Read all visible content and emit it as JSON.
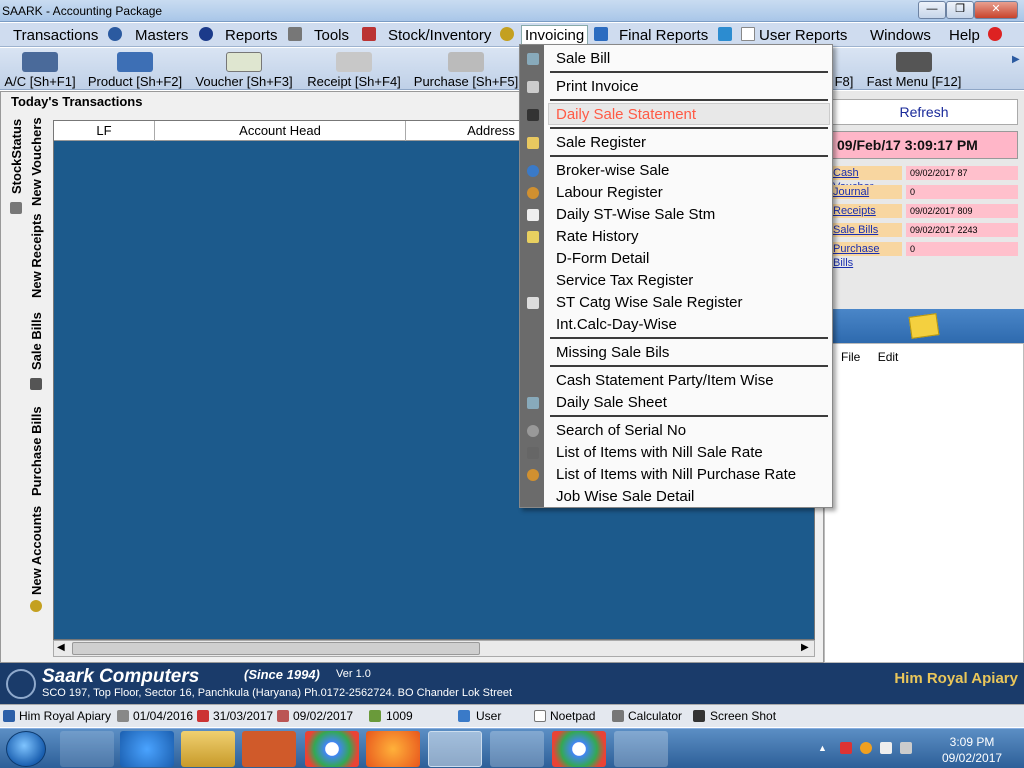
{
  "window": {
    "title": "SAARK - Accounting Package",
    "btn_min": "—",
    "btn_max": "❐",
    "btn_close": "✕"
  },
  "menubar": [
    {
      "label": "Transactions"
    },
    {
      "label": "Masters"
    },
    {
      "label": "Reports"
    },
    {
      "label": "Tools"
    },
    {
      "label": "Stock/Inventory"
    },
    {
      "label": "Invoicing"
    },
    {
      "label": "Final Reports"
    },
    {
      "label": "User Reports"
    },
    {
      "label": "Windows"
    },
    {
      "label": "Help"
    }
  ],
  "toolbar": [
    {
      "label": "A/C [Sh+F1]"
    },
    {
      "label": "Product [Sh+F2]"
    },
    {
      "label": "Voucher [Sh+F3]"
    },
    {
      "label": "Receipt [Sh+F4]"
    },
    {
      "label": "Purchase [Sh+F5]"
    },
    {
      "label": "F8]"
    },
    {
      "label": "Fast Menu [F12]"
    }
  ],
  "left": {
    "section_title": "Today's Transactions",
    "vertical_tabs": [
      "StockStatus",
      "New Vouchers",
      "New Receipts",
      "Sale Bills",
      "Purchase Bills",
      "New Accounts"
    ],
    "grid_headers": [
      "LF",
      "Account Head",
      "Address"
    ]
  },
  "right": {
    "refresh_label": "Refresh",
    "datetime": "09/Feb/17 3:09:17 PM",
    "summary": [
      {
        "label": "Cash Voucher",
        "value": "09/02/2017 87"
      },
      {
        "label": "Journal",
        "value": "0"
      },
      {
        "label": "Receipts",
        "value": "09/02/2017 809"
      },
      {
        "label": "Sale Bills",
        "value": "09/02/2017 2243"
      },
      {
        "label": "Purchase Bills",
        "value": "0"
      }
    ],
    "note_menu": [
      "File",
      "Edit"
    ]
  },
  "dropdown": {
    "items": [
      {
        "label": "Sale Bill"
      },
      {
        "label": "Print Invoice"
      },
      {
        "label": "Daily Sale Statement"
      },
      {
        "label": "Sale Register"
      },
      {
        "label": "Broker-wise Sale"
      },
      {
        "label": "Labour Register"
      },
      {
        "label": "Daily ST-Wise Sale Stm"
      },
      {
        "label": "Rate History"
      },
      {
        "label": "D-Form Detail"
      },
      {
        "label": "Service Tax Register"
      },
      {
        "label": "ST Catg Wise Sale Register"
      },
      {
        "label": "Int.Calc-Day-Wise"
      },
      {
        "label": "Missing Sale Bils"
      },
      {
        "label": "Cash Statement Party/Item Wise"
      },
      {
        "label": "Daily Sale Sheet"
      },
      {
        "label": "Search of Serial No"
      },
      {
        "label": "List of Items with Nill Sale Rate"
      },
      {
        "label": "List of Items with Nill Purchase Rate"
      },
      {
        "label": "Job Wise Sale Detail"
      }
    ]
  },
  "footer": {
    "company": "Saark Computers",
    "since": "(Since 1994)",
    "version": "Ver 1.0",
    "address": "SCO 197, Top Floor, Sector 16, Panchkula (Haryana) Ph.0172-2562724.  BO Chander Lok Street",
    "client": "Him Royal Apiary"
  },
  "statusbar": [
    {
      "label": "Him Royal Apiary"
    },
    {
      "label": "01/04/2016"
    },
    {
      "label": "31/03/2017"
    },
    {
      "label": "09/02/2017"
    },
    {
      "label": "1009"
    },
    {
      "label": "User"
    },
    {
      "label": "Noetpad"
    },
    {
      "label": "Calculator"
    },
    {
      "label": "Screen Shot"
    }
  ],
  "taskbar": {
    "time": "3:09 PM",
    "date": "09/02/2017"
  }
}
